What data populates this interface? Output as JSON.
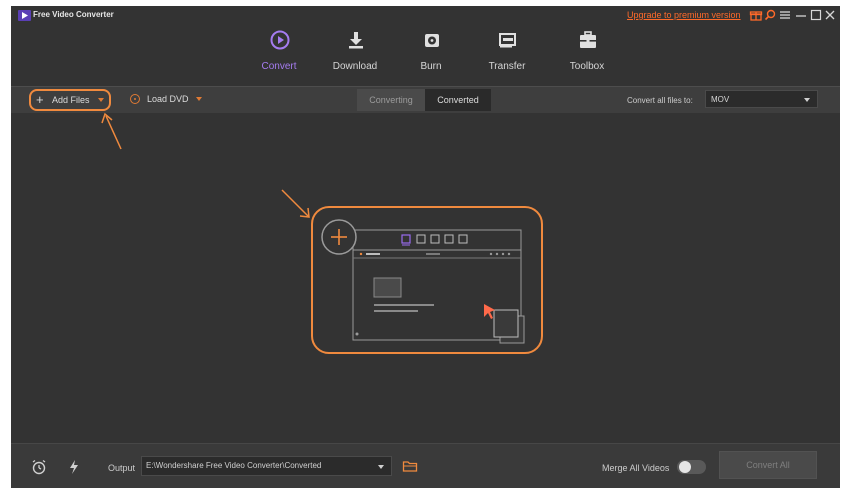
{
  "app": {
    "title": "Free Video Converter",
    "upgrade_link": "Upgrade to premium version",
    "accent_color": "#8c5ee0",
    "highlight_color": "#f08a3e"
  },
  "nav": {
    "items": [
      {
        "label": "Convert",
        "icon": "convert-icon",
        "active": true
      },
      {
        "label": "Download",
        "icon": "download-icon",
        "active": false
      },
      {
        "label": "Burn",
        "icon": "burn-icon",
        "active": false
      },
      {
        "label": "Transfer",
        "icon": "transfer-icon",
        "active": false
      },
      {
        "label": "Toolbox",
        "icon": "toolbox-icon",
        "active": false
      }
    ]
  },
  "toolbar": {
    "add_files_label": "Add Files",
    "load_dvd_label": "Load DVD",
    "tabs": [
      {
        "label": "Converting",
        "active": false
      },
      {
        "label": "Converted",
        "active": true
      }
    ],
    "convert_all_label": "Convert all files to:",
    "format_value": "MOV"
  },
  "bottom": {
    "output_label": "Output",
    "output_path": "E:\\Wondershare Free Video Converter\\Converted",
    "merge_label": "Merge All Videos",
    "merge_enabled": false,
    "convert_all_button": "Convert All"
  }
}
